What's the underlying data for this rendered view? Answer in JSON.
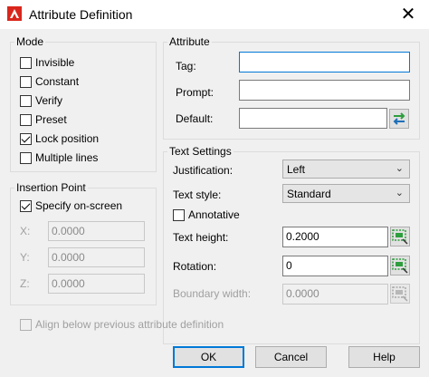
{
  "window": {
    "title": "Attribute Definition",
    "close_glyph": "✕"
  },
  "mode": {
    "label": "Mode",
    "options": [
      {
        "label": "Invisible",
        "checked": false
      },
      {
        "label": "Constant",
        "checked": false
      },
      {
        "label": "Verify",
        "checked": false
      },
      {
        "label": "Preset",
        "checked": false
      },
      {
        "label": "Lock position",
        "checked": true
      },
      {
        "label": "Multiple lines",
        "checked": false
      }
    ]
  },
  "insertion_point": {
    "label": "Insertion Point",
    "specify_on_screen": {
      "label": "Specify on-screen",
      "checked": true
    },
    "x": {
      "label": "X:",
      "value": "0.0000"
    },
    "y": {
      "label": "Y:",
      "value": "0.0000"
    },
    "z": {
      "label": "Z:",
      "value": "0.0000"
    }
  },
  "attribute": {
    "label": "Attribute",
    "tag": {
      "label": "Tag:",
      "value": ""
    },
    "prompt": {
      "label": "Prompt:",
      "value": ""
    },
    "default": {
      "label": "Default:",
      "value": ""
    }
  },
  "text_settings": {
    "label": "Text Settings",
    "justification": {
      "label": "Justification:",
      "value": "Left"
    },
    "text_style": {
      "label": "Text style:",
      "value": "Standard"
    },
    "annotative": {
      "label": "Annotative",
      "checked": false
    },
    "text_height": {
      "label": "Text height:",
      "value": "0.2000"
    },
    "rotation": {
      "label": "Rotation:",
      "value": "0"
    },
    "boundary_width": {
      "label": "Boundary width:",
      "value": "0.0000"
    }
  },
  "align_below": {
    "label": "Align below previous attribute definition",
    "checked": false
  },
  "buttons": {
    "ok": "OK",
    "cancel": "Cancel",
    "help": "Help"
  },
  "colors": {
    "accent": "#0078d7",
    "app_icon": "#d9261c",
    "pick_green": "#2e9e3e"
  }
}
